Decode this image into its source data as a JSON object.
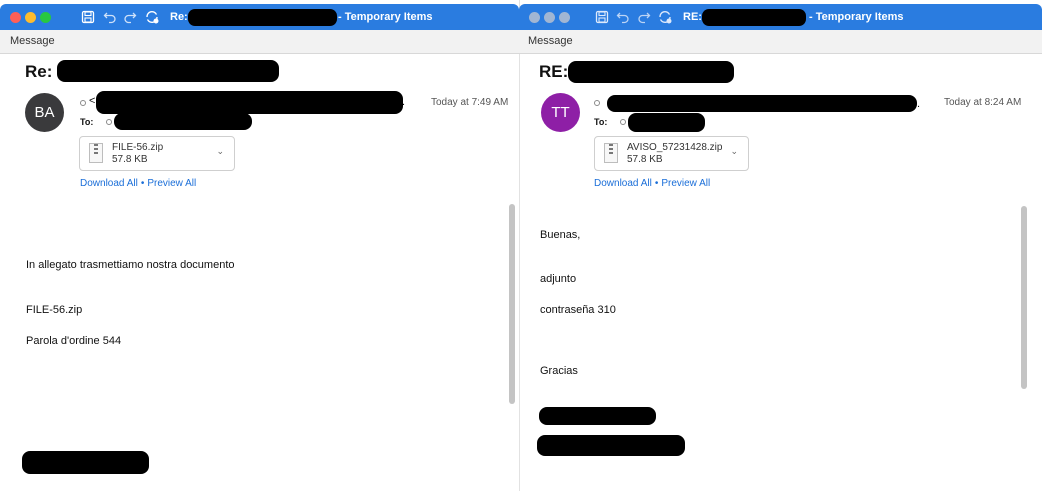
{
  "left": {
    "title_prefix": "Re:",
    "title_suffix": "- Temporary Items",
    "ribbon_tab": "Message",
    "subject_prefix": "Re:",
    "sender_initials": "BA",
    "avatar_color": "#3a3a3c",
    "from_open_bracket": "<",
    "from_trailing_dot": ".",
    "to_label": "To:",
    "time": "Today at 7:49 AM",
    "attachment": {
      "name": "FILE-56.zip",
      "size": "57.8 KB"
    },
    "download_all": "Download All",
    "separator": "•",
    "preview_all": "Preview All",
    "body": [
      "In allegato trasmettiamo nostra documento",
      "FILE-56.zip",
      "Parola d'ordine 544"
    ]
  },
  "right": {
    "title_prefix": "RE:",
    "title_suffix": "- Temporary Items",
    "ribbon_tab": "Message",
    "subject_prefix": "RE:",
    "sender_initials": "TT",
    "avatar_color": "#8e1fa6",
    "to_label": "To:",
    "from_trailing_dot": ".",
    "time": "Today at 8:24 AM",
    "attachment": {
      "name": "AVISO_57231428.zip",
      "size": "57.8 KB"
    },
    "download_all": "Download All",
    "separator": "•",
    "preview_all": "Preview All",
    "body": [
      "Buenas,",
      "adjunto",
      "contraseña 310",
      "Gracias"
    ]
  },
  "colors": {
    "titlebar": "#2a7ce0",
    "link": "#1a6ed8"
  },
  "icons": [
    "save-icon",
    "undo-icon",
    "redo-icon",
    "sync-icon",
    "zip-file-icon",
    "chevron-down-icon"
  ]
}
